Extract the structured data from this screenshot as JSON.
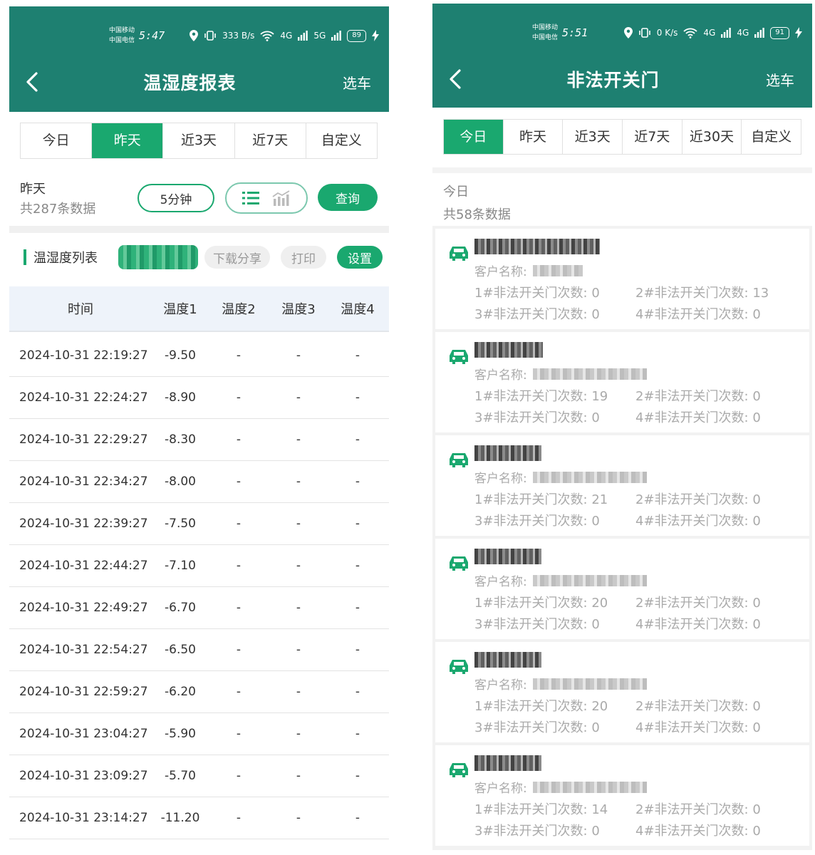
{
  "left": {
    "status": {
      "carrier1": "中国移动",
      "carrier2": "中国电信",
      "time": "5:47",
      "speed": "333 B/s",
      "net1": "4G",
      "net2": "5G",
      "battery": "89"
    },
    "nav": {
      "title": "温湿度报表",
      "pick_label": "选车"
    },
    "tabs": [
      "今日",
      "昨天",
      "近3天",
      "近7天",
      "自定义"
    ],
    "active_tab": 1,
    "query": {
      "label": "昨天",
      "count": "共287条数据",
      "interval": "5分钟",
      "submit": "查询"
    },
    "list": {
      "title": "温湿度列表",
      "download": "下载分享",
      "print": "打印",
      "settings": "设置"
    },
    "table": {
      "headers": [
        "时间",
        "温度1",
        "温度2",
        "温度3",
        "温度4"
      ],
      "rows": [
        [
          "2024-10-31 22:19:27",
          "-9.50",
          "-",
          "-",
          "-"
        ],
        [
          "2024-10-31 22:24:27",
          "-8.90",
          "-",
          "-",
          "-"
        ],
        [
          "2024-10-31 22:29:27",
          "-8.30",
          "-",
          "-",
          "-"
        ],
        [
          "2024-10-31 22:34:27",
          "-8.00",
          "-",
          "-",
          "-"
        ],
        [
          "2024-10-31 22:39:27",
          "-7.50",
          "-",
          "-",
          "-"
        ],
        [
          "2024-10-31 22:44:27",
          "-7.10",
          "-",
          "-",
          "-"
        ],
        [
          "2024-10-31 22:49:27",
          "-6.70",
          "-",
          "-",
          "-"
        ],
        [
          "2024-10-31 22:54:27",
          "-6.50",
          "-",
          "-",
          "-"
        ],
        [
          "2024-10-31 22:59:27",
          "-6.20",
          "-",
          "-",
          "-"
        ],
        [
          "2024-10-31 23:04:27",
          "-5.90",
          "-",
          "-",
          "-"
        ],
        [
          "2024-10-31 23:09:27",
          "-5.70",
          "-",
          "-",
          "-"
        ],
        [
          "2024-10-31 23:14:27",
          "-11.20",
          "-",
          "-",
          "-"
        ]
      ]
    }
  },
  "right": {
    "status": {
      "carrier1": "中国移动",
      "carrier2": "中国电信",
      "time": "5:51",
      "speed": "0 K/s",
      "net1": "4G",
      "net2": "4G",
      "battery": "91"
    },
    "nav": {
      "title": "非法开关门",
      "pick_label": "选车"
    },
    "tabs": [
      "今日",
      "昨天",
      "近3天",
      "近7天",
      "近30天",
      "自定义"
    ],
    "active_tab": 0,
    "summary": {
      "label": "今日",
      "count": "共58条数据"
    },
    "customer_label": "客户名称:",
    "cards": [
      {
        "d1": "1#非法开关门次数: 0",
        "d2": "2#非法开关门次数: 13",
        "d3": "3#非法开关门次数: 0",
        "d4": "4#非法开关门次数: 0"
      },
      {
        "d1": "1#非法开关门次数: 19",
        "d2": "2#非法开关门次数: 0",
        "d3": "3#非法开关门次数: 0",
        "d4": "4#非法开关门次数: 0"
      },
      {
        "d1": "1#非法开关门次数: 21",
        "d2": "2#非法开关门次数: 0",
        "d3": "3#非法开关门次数: 0",
        "d4": "4#非法开关门次数: 0"
      },
      {
        "d1": "1#非法开关门次数: 20",
        "d2": "2#非法开关门次数: 0",
        "d3": "3#非法开关门次数: 0",
        "d4": "4#非法开关门次数: 0"
      },
      {
        "d1": "1#非法开关门次数: 20",
        "d2": "2#非法开关门次数: 0",
        "d3": "3#非法开关门次数: 0",
        "d4": "4#非法开关门次数: 0"
      },
      {
        "d1": "1#非法开关门次数: 14",
        "d2": "2#非法开关门次数: 0",
        "d3": "3#非法开关门次数: 0",
        "d4": "4#非法开关门次数: 0"
      }
    ]
  },
  "colors": {
    "header": "#1e8071",
    "accent": "#1aa86f"
  }
}
